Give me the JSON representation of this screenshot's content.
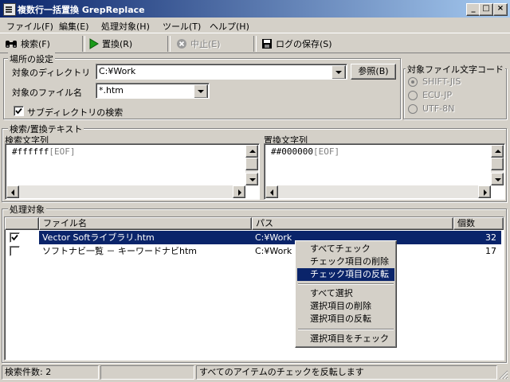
{
  "window": {
    "title": "複数行一括置換 GrepReplace"
  },
  "menu": [
    "ファイル(F)",
    "編集(E)",
    "処理対象(H)",
    "ツール(T)",
    "ヘルプ(H)"
  ],
  "toolbar": {
    "search": "検索(F)",
    "replace": "置換(R)",
    "stop": "中止(E)",
    "save_log": "ログの保存(S)"
  },
  "location": {
    "group_label": "場所の設定",
    "dir_label": "対象のディレクトリ",
    "dir_value": "C:¥Work",
    "browse_button": "参照(B)",
    "filename_label": "対象のファイル名",
    "filename_value": "*.htm",
    "subdir_label": "サブディレクトリの検索",
    "subdir_checked": true
  },
  "encoding": {
    "group_label": "対象ファイル文字コード",
    "options": [
      "SHIFT-JIS",
      "ECU-JP",
      "UTF-8N"
    ],
    "selected": "SHIFT-JIS"
  },
  "text": {
    "group_label": "検索/置換テキスト",
    "search_label": "検索文字列",
    "search_value": "#ffffff",
    "replace_label": "置換文字列",
    "replace_value": "##000000",
    "eof": "[EOF]"
  },
  "targets": {
    "group_label": "処理対象",
    "columns": [
      "ファイル名",
      "パス",
      "個数"
    ],
    "rows": [
      {
        "checked": true,
        "name": "Vector Softライブラリ.htm",
        "path": "C:¥Work",
        "count": "32",
        "selected": true
      },
      {
        "checked": false,
        "name": "ソフトナビ一覧 － キーワードナビhtm",
        "path": "C:¥Work",
        "count": "17",
        "selected": false
      }
    ]
  },
  "context_menu": {
    "items": [
      "すべてチェック",
      "チェック項目の削除",
      "チェック項目の反転",
      "すべて選択",
      "選択項目の削除",
      "選択項目の反転",
      "選択項目をチェック"
    ],
    "highlighted": "チェック項目の反転"
  },
  "status": {
    "count": "検索件数: 2",
    "middle": "",
    "message": "すべてのアイテムのチェックを反転します"
  },
  "colors": {
    "titlebar": "#0a246a",
    "face": "#d4d0c8",
    "selection": "#0a246a"
  }
}
